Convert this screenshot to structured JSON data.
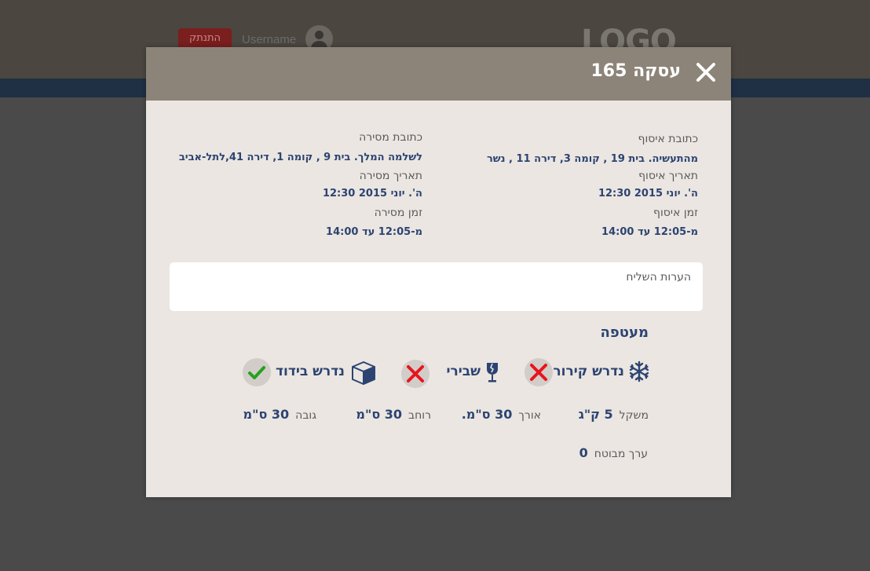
{
  "header": {
    "logout_label": "התנתק",
    "username": "Username",
    "logo_text": "LOGO"
  },
  "modal": {
    "title": "עסקה 165",
    "pickup": {
      "address_label": "כתובת איסוף",
      "address_value": "מהתעשיה. בית 19 , קומה 3, דירה 11 , נשר",
      "date_label": "תאריך איסוף",
      "date_value": "ה'. יוני 2015 12:30",
      "time_label": "זמן איסוף",
      "time_value": "מ-12:05 עד 14:00"
    },
    "delivery": {
      "address_label": "כתובת מסירה",
      "address_value": "לשלמה המלך. בית 9 , קומה 1, דירה 41,לתל-אביב",
      "date_label": "תאריך מסירה",
      "date_value": "ה'. יוני 2015 12:30",
      "time_label": "זמן מסירה",
      "time_value": "מ-12:05 עד 14:00"
    },
    "notes_label": "הערות השליח",
    "package": {
      "title": "מעטפה",
      "flags": [
        {
          "label": "נדרש קירור",
          "icon": "snowflake-icon",
          "status": false
        },
        {
          "label": "שבירי",
          "icon": "fragile-glass-icon",
          "status": false
        },
        {
          "label": "נדרש בידוד",
          "icon": "box-icon",
          "status": true
        }
      ],
      "weight_label": "משקל",
      "weight_value": "5 ק\"ג",
      "length_label": "אורך",
      "length_value": "30 ס\"מ.",
      "width_label": "רוחב",
      "width_value": "30 ס\"מ",
      "height_label": "גובה",
      "height_value": "30 ס\"מ",
      "insured_label": "ערך מבוטח",
      "insured_value": "0"
    }
  },
  "colors": {
    "accent": "#2c4472",
    "header": "#8c8479",
    "modal_bg": "#ebe6e1",
    "no": "#e8141d",
    "yes": "#27a020"
  }
}
